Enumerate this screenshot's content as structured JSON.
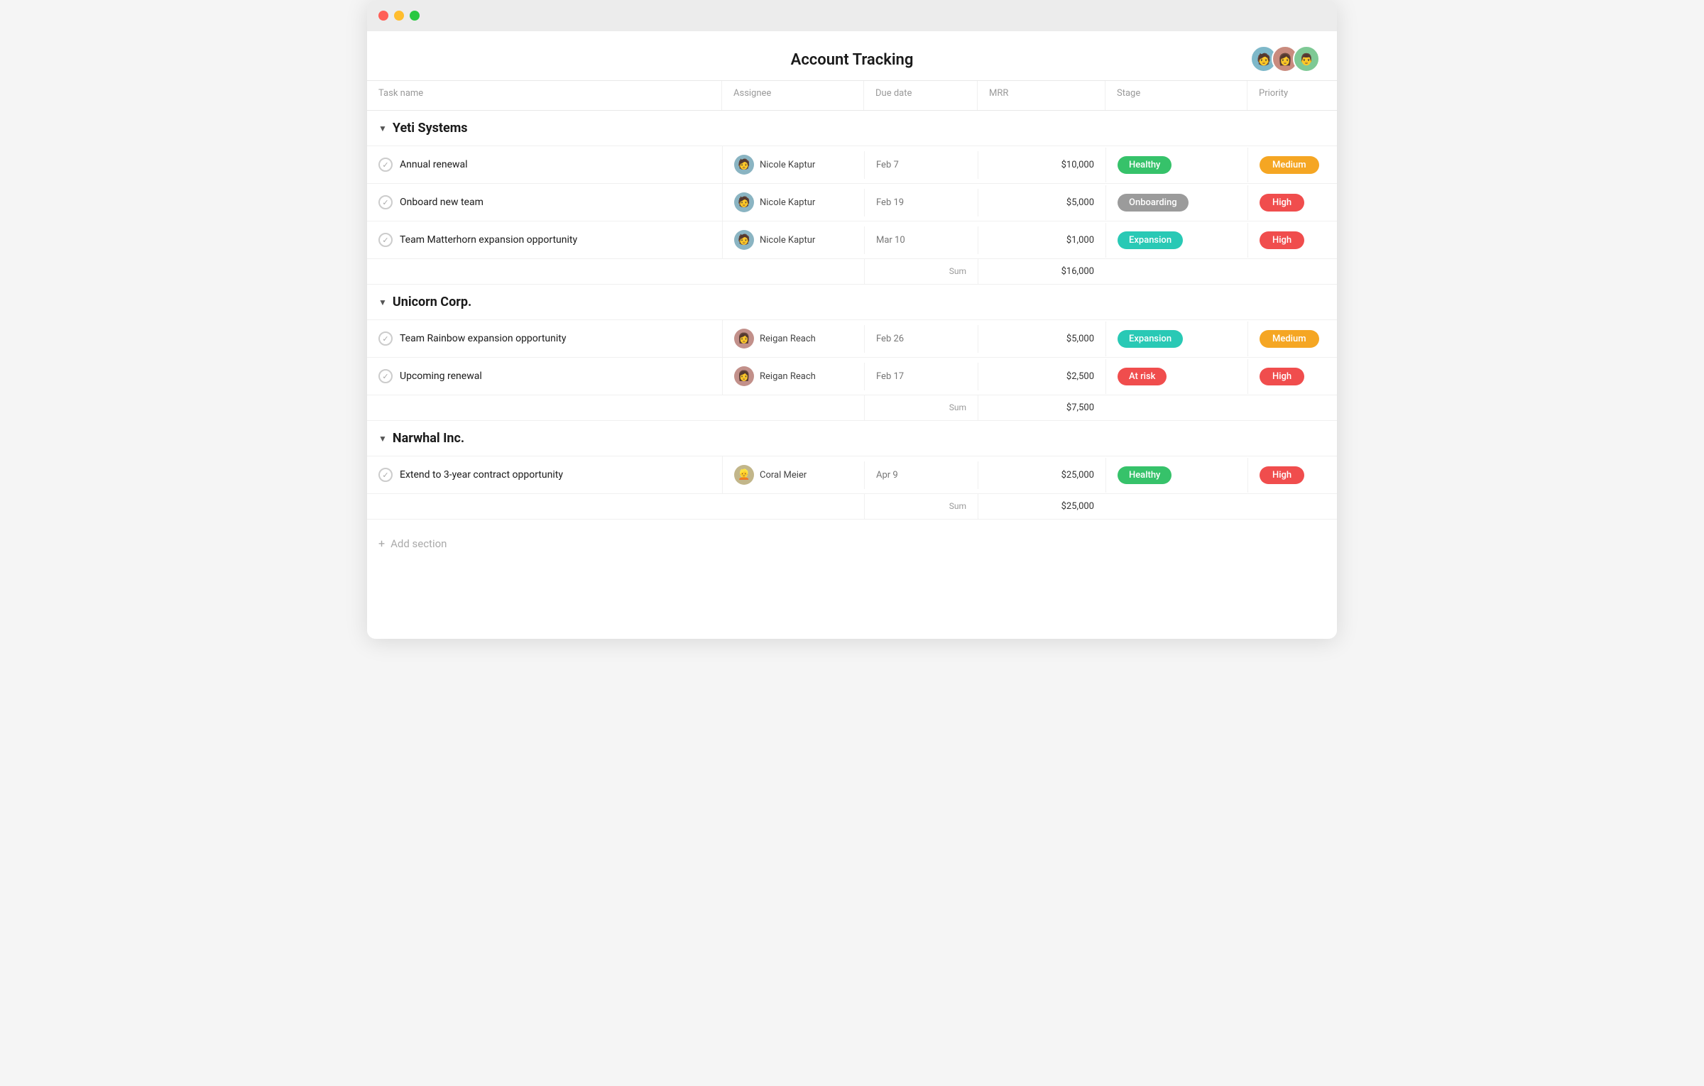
{
  "window": {
    "title": "Account Tracking"
  },
  "header": {
    "title": "Account Tracking",
    "avatars": [
      "😊",
      "😎",
      "🙂"
    ]
  },
  "table": {
    "columns": {
      "task_name": "Task name",
      "assignee": "Assignee",
      "due_date": "Due date",
      "mrr": "MRR",
      "stage": "Stage",
      "priority": "Priority"
    },
    "add_column_icon": "+",
    "sections": [
      {
        "id": "yeti",
        "name": "Yeti Systems",
        "tasks": [
          {
            "name": "Annual renewal",
            "assignee": "Nicole Kaptur",
            "due_date": "Feb 7",
            "mrr": "$10,000",
            "stage": "Healthy",
            "stage_type": "healthy",
            "priority": "Medium",
            "priority_type": "medium"
          },
          {
            "name": "Onboard new team",
            "assignee": "Nicole Kaptur",
            "due_date": "Feb 19",
            "mrr": "$5,000",
            "stage": "Onboarding",
            "stage_type": "onboarding",
            "priority": "High",
            "priority_type": "high"
          },
          {
            "name": "Team Matterhorn expansion opportunity",
            "assignee": "Nicole Kaptur",
            "due_date": "Mar 10",
            "mrr": "$1,000",
            "stage": "Expansion",
            "stage_type": "expansion",
            "priority": "High",
            "priority_type": "high"
          }
        ],
        "sum_label": "Sum",
        "sum_value": "$16,000"
      },
      {
        "id": "unicorn",
        "name": "Unicorn Corp.",
        "tasks": [
          {
            "name": "Team Rainbow expansion opportunity",
            "assignee": "Reigan Reach",
            "due_date": "Feb 26",
            "mrr": "$5,000",
            "stage": "Expansion",
            "stage_type": "expansion",
            "priority": "Medium",
            "priority_type": "medium"
          },
          {
            "name": "Upcoming renewal",
            "assignee": "Reigan Reach",
            "due_date": "Feb 17",
            "mrr": "$2,500",
            "stage": "At risk",
            "stage_type": "at-risk",
            "priority": "High",
            "priority_type": "high"
          }
        ],
        "sum_label": "Sum",
        "sum_value": "$7,500"
      },
      {
        "id": "narwhal",
        "name": "Narwhal Inc.",
        "tasks": [
          {
            "name": "Extend to 3-year contract opportunity",
            "assignee": "Coral Meier",
            "due_date": "Apr 9",
            "mrr": "$25,000",
            "stage": "Healthy",
            "stage_type": "healthy",
            "priority": "High",
            "priority_type": "high"
          }
        ],
        "sum_label": "Sum",
        "sum_value": "$25,000"
      }
    ],
    "add_section_label": "Add section"
  }
}
